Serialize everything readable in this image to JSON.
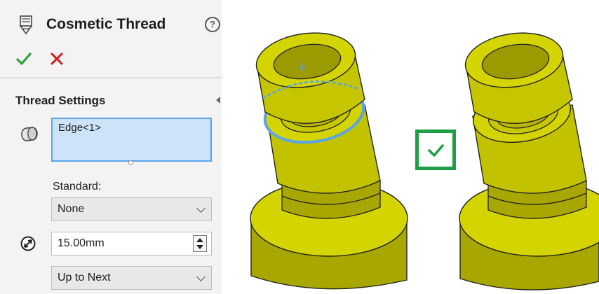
{
  "panel": {
    "title": "Cosmetic Thread",
    "help_icon": "?",
    "ok_icon": "checkmark-icon",
    "cancel_icon": "x-icon",
    "section_title": "Thread Settings",
    "edge_selection": "Edge<1>",
    "standard_label": "Standard:",
    "standard_value": "None",
    "diameter_value": "15.00mm",
    "end_condition_value": "Up to Next"
  },
  "colors": {
    "model_yellow": "#d4d400",
    "model_shade": "#a7a700",
    "selection_blue": "#5aa5e8",
    "ok_green": "#2e9e3e",
    "cancel_red": "#d11a1a",
    "badge_green": "#1f9e45"
  },
  "icons": {
    "feature": "cosmetic-thread-icon",
    "edge": "edge-icon",
    "diameter": "diameter-icon",
    "badge": "checkmark-icon"
  }
}
